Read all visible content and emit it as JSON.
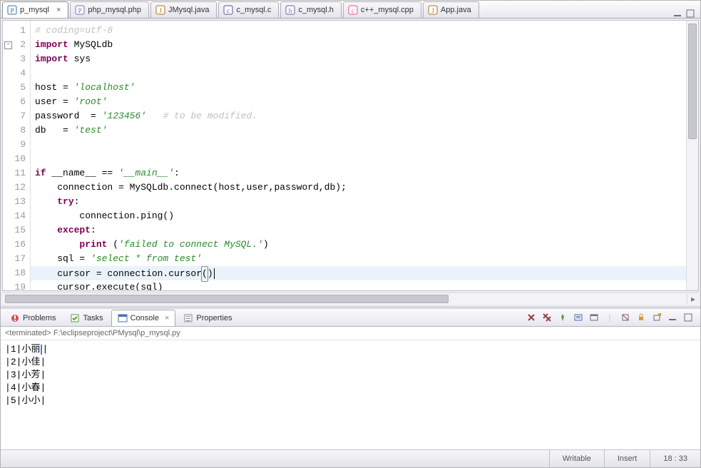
{
  "tabs": [
    {
      "label": "p_mysql",
      "icon": "python",
      "active": true
    },
    {
      "label": "php_mysql.php",
      "icon": "php",
      "active": false
    },
    {
      "label": "JMysql.java",
      "icon": "java",
      "active": false
    },
    {
      "label": "c_mysql.c",
      "icon": "c",
      "active": false
    },
    {
      "label": "c_mysql.h",
      "icon": "h",
      "active": false
    },
    {
      "label": "c++_mysql.cpp",
      "icon": "cpp",
      "active": false
    },
    {
      "label": "App.java",
      "icon": "java",
      "active": false
    }
  ],
  "code": {
    "lines": [
      {
        "n": 1,
        "segs": [
          {
            "cls": "cm",
            "t": "# coding=utf-8"
          }
        ]
      },
      {
        "n": 2,
        "fold": "minus",
        "segs": [
          {
            "cls": "kw",
            "t": "import"
          },
          {
            "cls": "plain",
            "t": " MySQLdb"
          }
        ]
      },
      {
        "n": 3,
        "segs": [
          {
            "cls": "kw",
            "t": "import"
          },
          {
            "cls": "plain",
            "t": " sys"
          }
        ]
      },
      {
        "n": 4,
        "segs": [
          {
            "cls": "plain",
            "t": ""
          }
        ]
      },
      {
        "n": 5,
        "segs": [
          {
            "cls": "plain",
            "t": "host = "
          },
          {
            "cls": "str",
            "t": "'localhost'"
          }
        ]
      },
      {
        "n": 6,
        "segs": [
          {
            "cls": "plain",
            "t": "user = "
          },
          {
            "cls": "str",
            "t": "'root'"
          }
        ]
      },
      {
        "n": 7,
        "segs": [
          {
            "cls": "plain",
            "t": "password  = "
          },
          {
            "cls": "str",
            "t": "'123456'"
          },
          {
            "cls": "plain",
            "t": "   "
          },
          {
            "cls": "cm",
            "t": "# to be modified."
          }
        ]
      },
      {
        "n": 8,
        "segs": [
          {
            "cls": "plain",
            "t": "db   = "
          },
          {
            "cls": "str",
            "t": "'test'"
          }
        ]
      },
      {
        "n": 9,
        "segs": [
          {
            "cls": "plain",
            "t": ""
          }
        ]
      },
      {
        "n": 10,
        "segs": [
          {
            "cls": "plain",
            "t": ""
          }
        ]
      },
      {
        "n": 11,
        "segs": [
          {
            "cls": "kw",
            "t": "if"
          },
          {
            "cls": "plain",
            "t": " __name__ == "
          },
          {
            "cls": "str",
            "t": "'__main__'"
          },
          {
            "cls": "plain",
            "t": ":"
          }
        ]
      },
      {
        "n": 12,
        "segs": [
          {
            "cls": "plain",
            "t": "    connection = MySQLdb.connect(host,user,password,db);"
          }
        ]
      },
      {
        "n": 13,
        "segs": [
          {
            "cls": "plain",
            "t": "    "
          },
          {
            "cls": "kw",
            "t": "try"
          },
          {
            "cls": "plain",
            "t": ":"
          }
        ]
      },
      {
        "n": 14,
        "segs": [
          {
            "cls": "plain",
            "t": "        connection.ping()"
          }
        ]
      },
      {
        "n": 15,
        "segs": [
          {
            "cls": "plain",
            "t": "    "
          },
          {
            "cls": "kw",
            "t": "except"
          },
          {
            "cls": "plain",
            "t": ":"
          }
        ]
      },
      {
        "n": 16,
        "segs": [
          {
            "cls": "plain",
            "t": "        "
          },
          {
            "cls": "kw",
            "t": "print"
          },
          {
            "cls": "plain",
            "t": " ("
          },
          {
            "cls": "str",
            "t": "'failed to connect MySQL.'"
          },
          {
            "cls": "plain",
            "t": ")"
          }
        ]
      },
      {
        "n": 17,
        "segs": [
          {
            "cls": "plain",
            "t": "    sql = "
          },
          {
            "cls": "str",
            "t": "'select * from test'"
          }
        ]
      },
      {
        "n": 18,
        "current": true,
        "segs": [
          {
            "cls": "plain",
            "t": "    cursor = connection.cursor"
          },
          {
            "cls": "plain hlbox",
            "t": "("
          },
          {
            "cls": "plain",
            "t": ")"
          },
          {
            "cls": "caret",
            "t": ""
          }
        ]
      },
      {
        "n": 19,
        "segs": [
          {
            "cls": "plain",
            "t": "    cursor.execute(sql)"
          }
        ]
      }
    ]
  },
  "views": {
    "tabs": [
      {
        "label": "Problems",
        "icon": "problems",
        "active": false
      },
      {
        "label": "Tasks",
        "icon": "tasks",
        "active": false
      },
      {
        "label": "Console",
        "icon": "console",
        "active": true
      },
      {
        "label": "Properties",
        "icon": "properties",
        "active": false
      }
    ],
    "header": "<terminated> F:\\eclipseproject\\PMysql\\p_mysql.py",
    "output": [
      {
        "id": "1",
        "name": "小丽",
        "sel": true
      },
      {
        "id": "2",
        "name": "小佳"
      },
      {
        "id": "3",
        "name": "小芳"
      },
      {
        "id": "4",
        "name": "小春"
      },
      {
        "id": "5",
        "name": "小小"
      }
    ]
  },
  "status": {
    "writable": "Writable",
    "insert": "Insert",
    "pos": "18 : 33"
  },
  "icons": {
    "close_x": "×",
    "chev_l": "◂",
    "chev_r": "▸"
  }
}
